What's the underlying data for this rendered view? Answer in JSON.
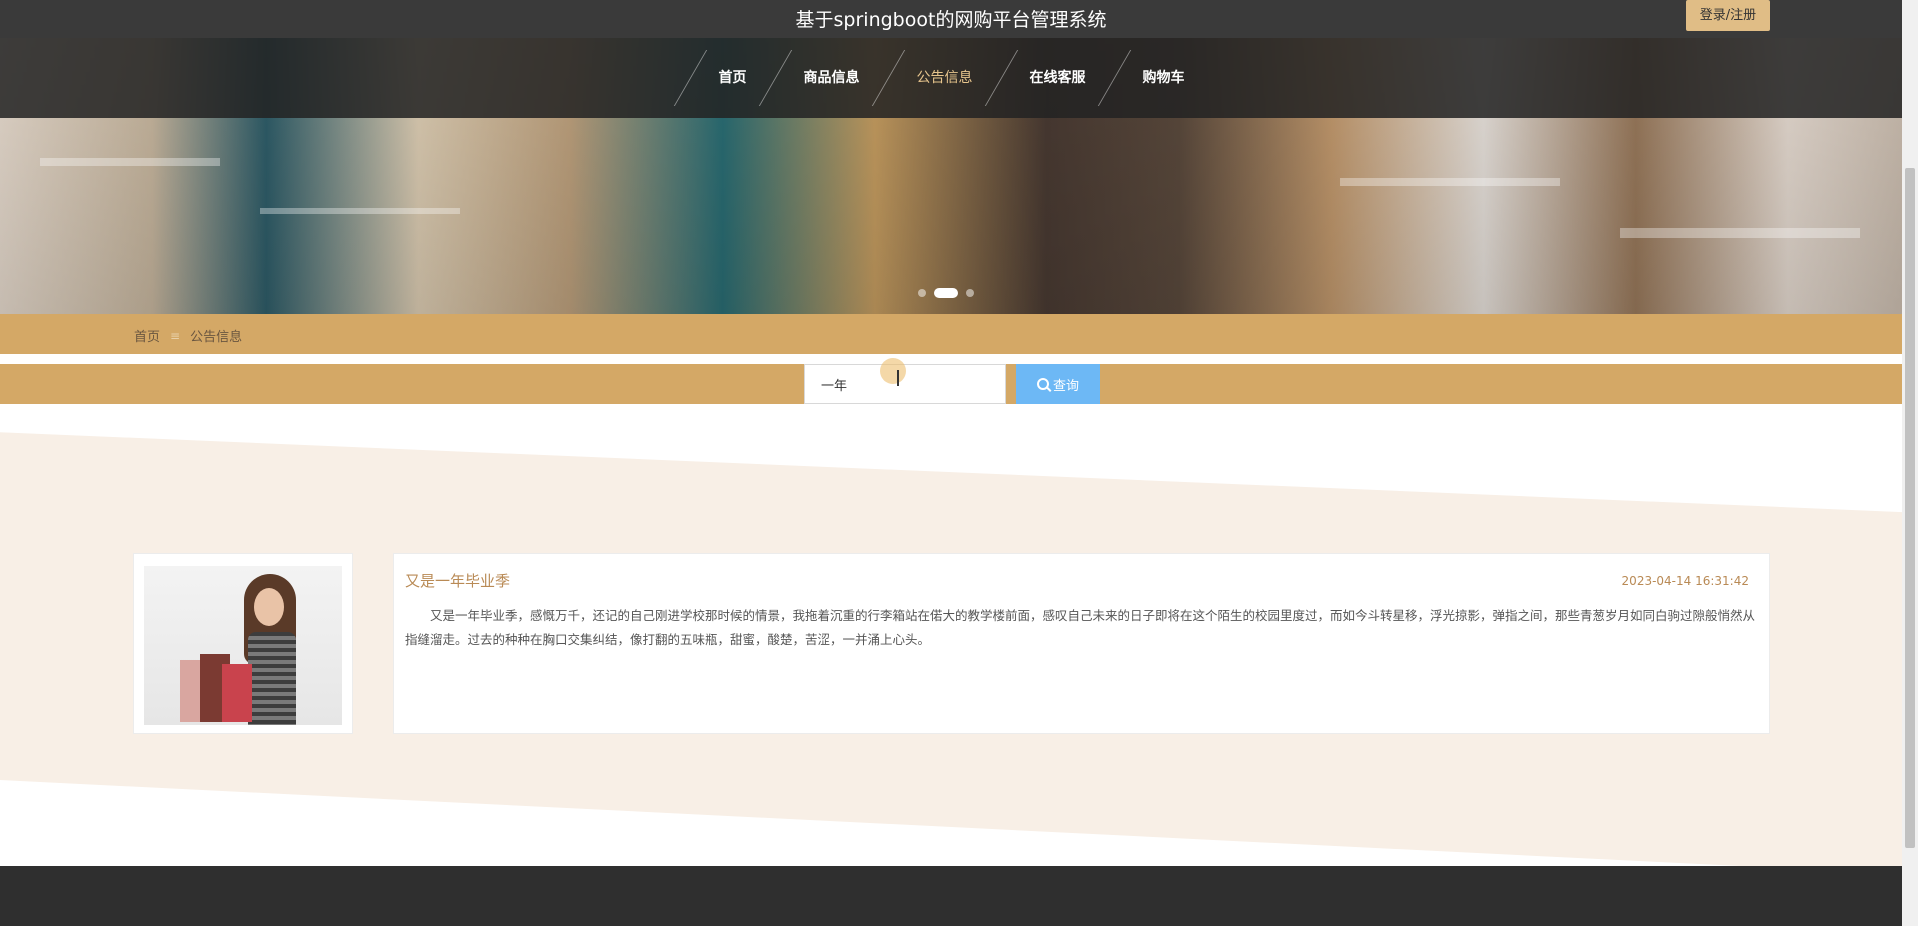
{
  "header": {
    "site_title": "基于springboot的网购平台管理系统",
    "login_label": "登录/注册"
  },
  "nav": {
    "items": [
      {
        "label": "首页",
        "active": false
      },
      {
        "label": "商品信息",
        "active": false
      },
      {
        "label": "公告信息",
        "active": true
      },
      {
        "label": "在线客服",
        "active": false
      },
      {
        "label": "购物车",
        "active": false
      }
    ]
  },
  "carousel": {
    "active_index": 1,
    "dot_count": 3
  },
  "breadcrumb": {
    "home": "首页",
    "separator": "≡",
    "current": "公告信息"
  },
  "search": {
    "value": "一年",
    "button_label": "查询"
  },
  "notice": {
    "title": "又是一年毕业季",
    "time": "2023-04-14 16:31:42",
    "body": "又是一年毕业季，感慨万千，还记的自己刚进学校那时候的情景，我拖着沉重的行李箱站在偌大的教学楼前面，感叹自己未来的日子即将在这个陌生的校园里度过，而如今斗转星移，浮光掠影，弹指之间，那些青葱岁月如同白驹过隙般悄然从指缝溜走。过去的种种在胸口交集纠结，像打翻的五味瓶，甜蜜，酸楚，苦涩，一并涌上心头。"
  },
  "colors": {
    "accent": "#d4a866",
    "header_bg": "#3a3a3a",
    "search_button": "#6db8f5",
    "notice_text": "#b98a55"
  }
}
